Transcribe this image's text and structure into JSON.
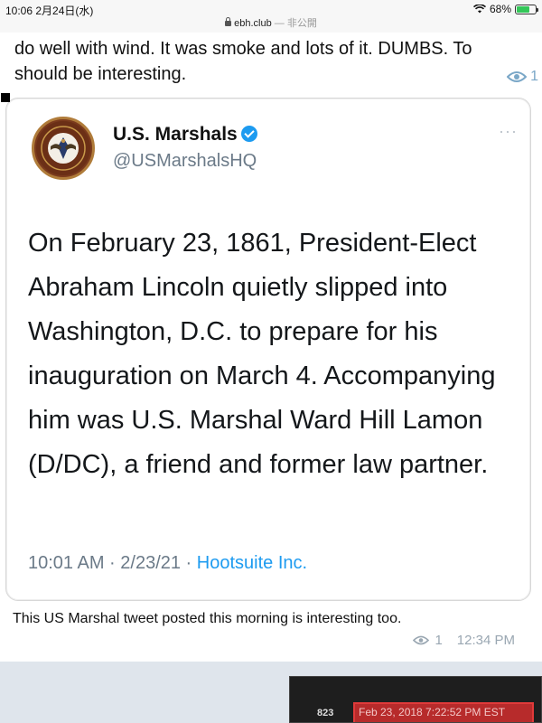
{
  "status_bar": {
    "time": "10:06",
    "date": "2月24日(水)",
    "domain": "ebh.club",
    "domain_note": "— 非公開",
    "battery_percent": "68%",
    "battery_level": 0.68
  },
  "message": {
    "top_text_line1": "do well with wind. It was smoke and lots of it. DUMBS. To",
    "top_text_line2": "should be interesting.",
    "top_views": "1",
    "tweet": {
      "name": "U.S. Marshals",
      "handle": "@USMarshalsHQ",
      "more": "···",
      "body": "On February 23, 1861, President-Elect Abraham Lincoln quietly slipped into Washington, D.C. to prepare for his inauguration on March 4. Accompanying him was U.S. Marshal Ward Hill Lamon (D/DC), a friend and former law partner.",
      "timestamp": "10:01 AM · 2/23/21 · ",
      "source": "Hootsuite Inc."
    },
    "caption": "This US Marshal tweet posted this morning is interesting too.",
    "views": "1",
    "time": "12:34 PM"
  },
  "next_message_preview": {
    "number": "823",
    "timestamp": "Feb 23, 2018 7:22:52 PM EST"
  }
}
